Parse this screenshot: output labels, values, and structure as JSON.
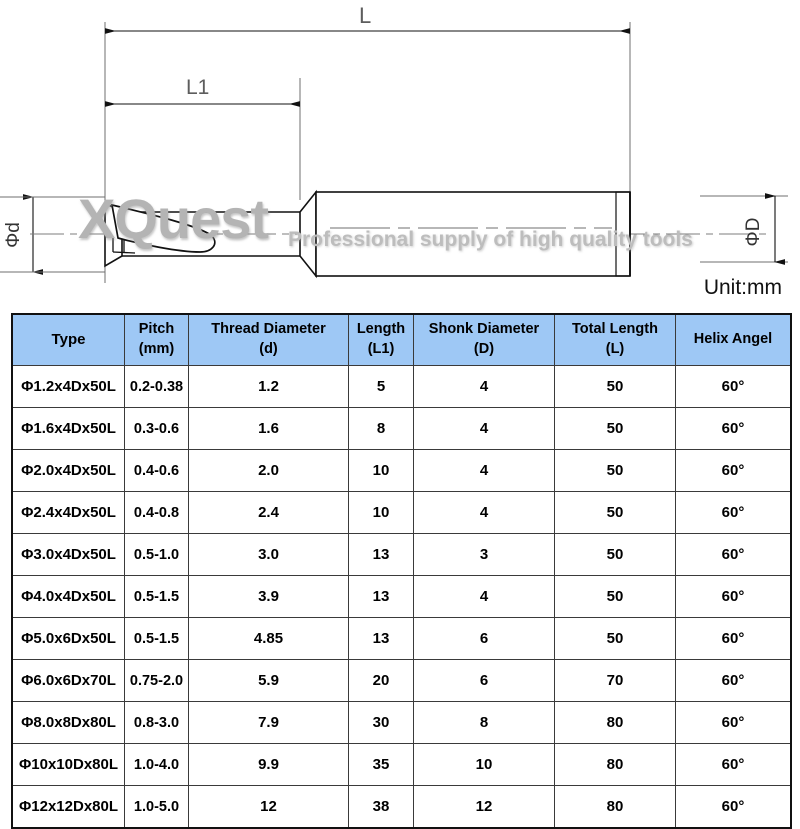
{
  "drawing": {
    "watermark_main": "XQuest",
    "watermark_sub": "Professional supply of high quality tools",
    "unit_label": "Unit:mm",
    "dim_total_length": "L",
    "dim_flute_length": "L1",
    "dim_thread_diameter": "Φd",
    "dim_shank_diameter": "ΦD",
    "line_color": "#111111"
  },
  "table": {
    "header_bg": "#9ec8f5",
    "columns": [
      {
        "line1": "Type",
        "line2": ""
      },
      {
        "line1": "Pitch",
        "line2": "(mm)"
      },
      {
        "line1": "Thread Diameter",
        "line2": "(d)"
      },
      {
        "line1": "Length",
        "line2": "(L1)"
      },
      {
        "line1": "Shonk Diameter",
        "line2": "(D)"
      },
      {
        "line1": "Total Length",
        "line2": "(L)"
      },
      {
        "line1": "Helix Angel",
        "line2": ""
      }
    ],
    "rows": [
      {
        "type": "Φ1.2x4Dx50L",
        "pitch": "0.2-0.38",
        "thread_diameter": "1.2",
        "length": "5",
        "shonk_diameter": "4",
        "total_length": "50",
        "helix_angle": "60°"
      },
      {
        "type": "Φ1.6x4Dx50L",
        "pitch": "0.3-0.6",
        "thread_diameter": "1.6",
        "length": "8",
        "shonk_diameter": "4",
        "total_length": "50",
        "helix_angle": "60°"
      },
      {
        "type": "Φ2.0x4Dx50L",
        "pitch": "0.4-0.6",
        "thread_diameter": "2.0",
        "length": "10",
        "shonk_diameter": "4",
        "total_length": "50",
        "helix_angle": "60°"
      },
      {
        "type": "Φ2.4x4Dx50L",
        "pitch": "0.4-0.8",
        "thread_diameter": "2.4",
        "length": "10",
        "shonk_diameter": "4",
        "total_length": "50",
        "helix_angle": "60°"
      },
      {
        "type": "Φ3.0x4Dx50L",
        "pitch": "0.5-1.0",
        "thread_diameter": "3.0",
        "length": "13",
        "shonk_diameter": "3",
        "total_length": "50",
        "helix_angle": "60°"
      },
      {
        "type": "Φ4.0x4Dx50L",
        "pitch": "0.5-1.5",
        "thread_diameter": "3.9",
        "length": "13",
        "shonk_diameter": "4",
        "total_length": "50",
        "helix_angle": "60°"
      },
      {
        "type": "Φ5.0x6Dx50L",
        "pitch": "0.5-1.5",
        "thread_diameter": "4.85",
        "length": "13",
        "shonk_diameter": "6",
        "total_length": "50",
        "helix_angle": "60°"
      },
      {
        "type": "Φ6.0x6Dx70L",
        "pitch": "0.75-2.0",
        "thread_diameter": "5.9",
        "length": "20",
        "shonk_diameter": "6",
        "total_length": "70",
        "helix_angle": "60°"
      },
      {
        "type": "Φ8.0x8Dx80L",
        "pitch": "0.8-3.0",
        "thread_diameter": "7.9",
        "length": "30",
        "shonk_diameter": "8",
        "total_length": "80",
        "helix_angle": "60°"
      },
      {
        "type": "Φ10x10Dx80L",
        "pitch": "1.0-4.0",
        "thread_diameter": "9.9",
        "length": "35",
        "shonk_diameter": "10",
        "total_length": "80",
        "helix_angle": "60°"
      },
      {
        "type": "Φ12x12Dx80L",
        "pitch": "1.0-5.0",
        "thread_diameter": "12",
        "length": "38",
        "shonk_diameter": "12",
        "total_length": "80",
        "helix_angle": "60°"
      }
    ]
  }
}
